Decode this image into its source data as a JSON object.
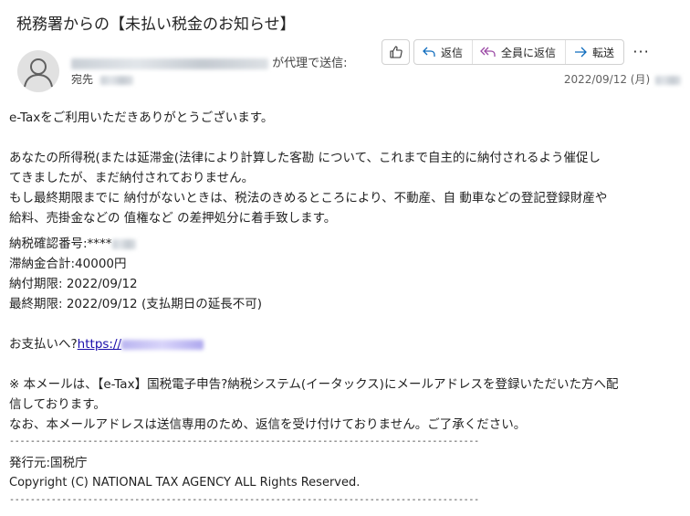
{
  "subject": "税務署からの【未払い税金のお知らせ】",
  "header": {
    "sender_suffix": "が代理で送信:",
    "to_label": "宛先",
    "date": "2022/09/12 (月)"
  },
  "actions": {
    "reply_label": "返信",
    "reply_all_label": "全員に返信",
    "forward_label": "転送"
  },
  "colors": {
    "link": "#1a0dab",
    "reply_all_icon": "#9b4aa5",
    "forward_icon": "#0f6cbd"
  },
  "body": {
    "line1": "e-Taxをご利用いただきありがとうございます。",
    "para1_line1": "あなたの所得税(または延滞金(法律により計算した客勘 について、これまで自主的に納付されるよう催促し",
    "para1_line2": "てきましたが、まだ納付されておりません。",
    "para1_line3": "もし最終期限までに 納付がないときは、税法のきめるところにより、不動産、自 動車などの登記登録財産や",
    "para1_line4": "給料、売掛金などの 值権など の差押処分に着手致します。",
    "confirm_no": "納税確認番号:****",
    "total": "滞納金合計:40000円",
    "due": "納付期限: 2022/09/12",
    "final_due": "最終期限: 2022/09/12 (支払期日の延長不可)",
    "pay_prefix": "お支払いへ?",
    "pay_link": "https://",
    "note_line1": "※ 本メールは、【e-Tax】国税電子申告?納税システム(イータックス)にメールアドレスを登録いただいた方へ配",
    "note_line2": "信しております。",
    "note_line3": "なお、本メールアドレスは送信専用のため、返信を受け付けておりません。ご了承ください。",
    "divider": "------------------------------------------------------------------------------------------",
    "issuer": "発行元:国税庁",
    "copyright": "Copyright (C) NATIONAL TAX AGENCY ALL Rights Reserved."
  }
}
